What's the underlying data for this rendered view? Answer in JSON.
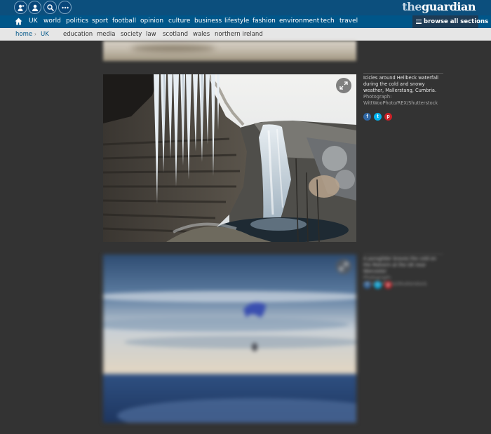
{
  "header": {
    "icons": [
      "contributor-icon",
      "profile-icon",
      "search-icon",
      "more-icon"
    ],
    "logo": {
      "the": "the",
      "guardian": "guardian"
    }
  },
  "nav": {
    "items": [
      "UK",
      "world",
      "politics",
      "sport",
      "football",
      "opinion",
      "culture",
      "business",
      "lifestyle",
      "fashion",
      "environment",
      "tech",
      "travel"
    ],
    "browse_label": "browse all sections"
  },
  "subnav": {
    "breadcrumb": [
      "home",
      "UK"
    ],
    "items": [
      "education",
      "media",
      "society",
      "law",
      "scotland",
      "wales",
      "northern ireland"
    ]
  },
  "gallery": {
    "items": [
      {
        "caption": "Icicles around Hellbeck waterfall during the cold and snowy weather, Mallerstang, Cumbria.",
        "credit_label": "Photograph:",
        "credit": "WittWooPhoto/REX/Shutterstock"
      },
      {
        "caption": "A paraglider braves the cold on the Malvern at the UK near Worcester",
        "credit": "Photograph: WittWooPhoto/Shutterstock"
      }
    ]
  },
  "colors": {
    "header": "#0c4f7d",
    "nav": "#005689",
    "background": "#333333",
    "facebook": "#3067a3",
    "twitter": "#03b3ee",
    "pinterest": "#cb2027"
  }
}
